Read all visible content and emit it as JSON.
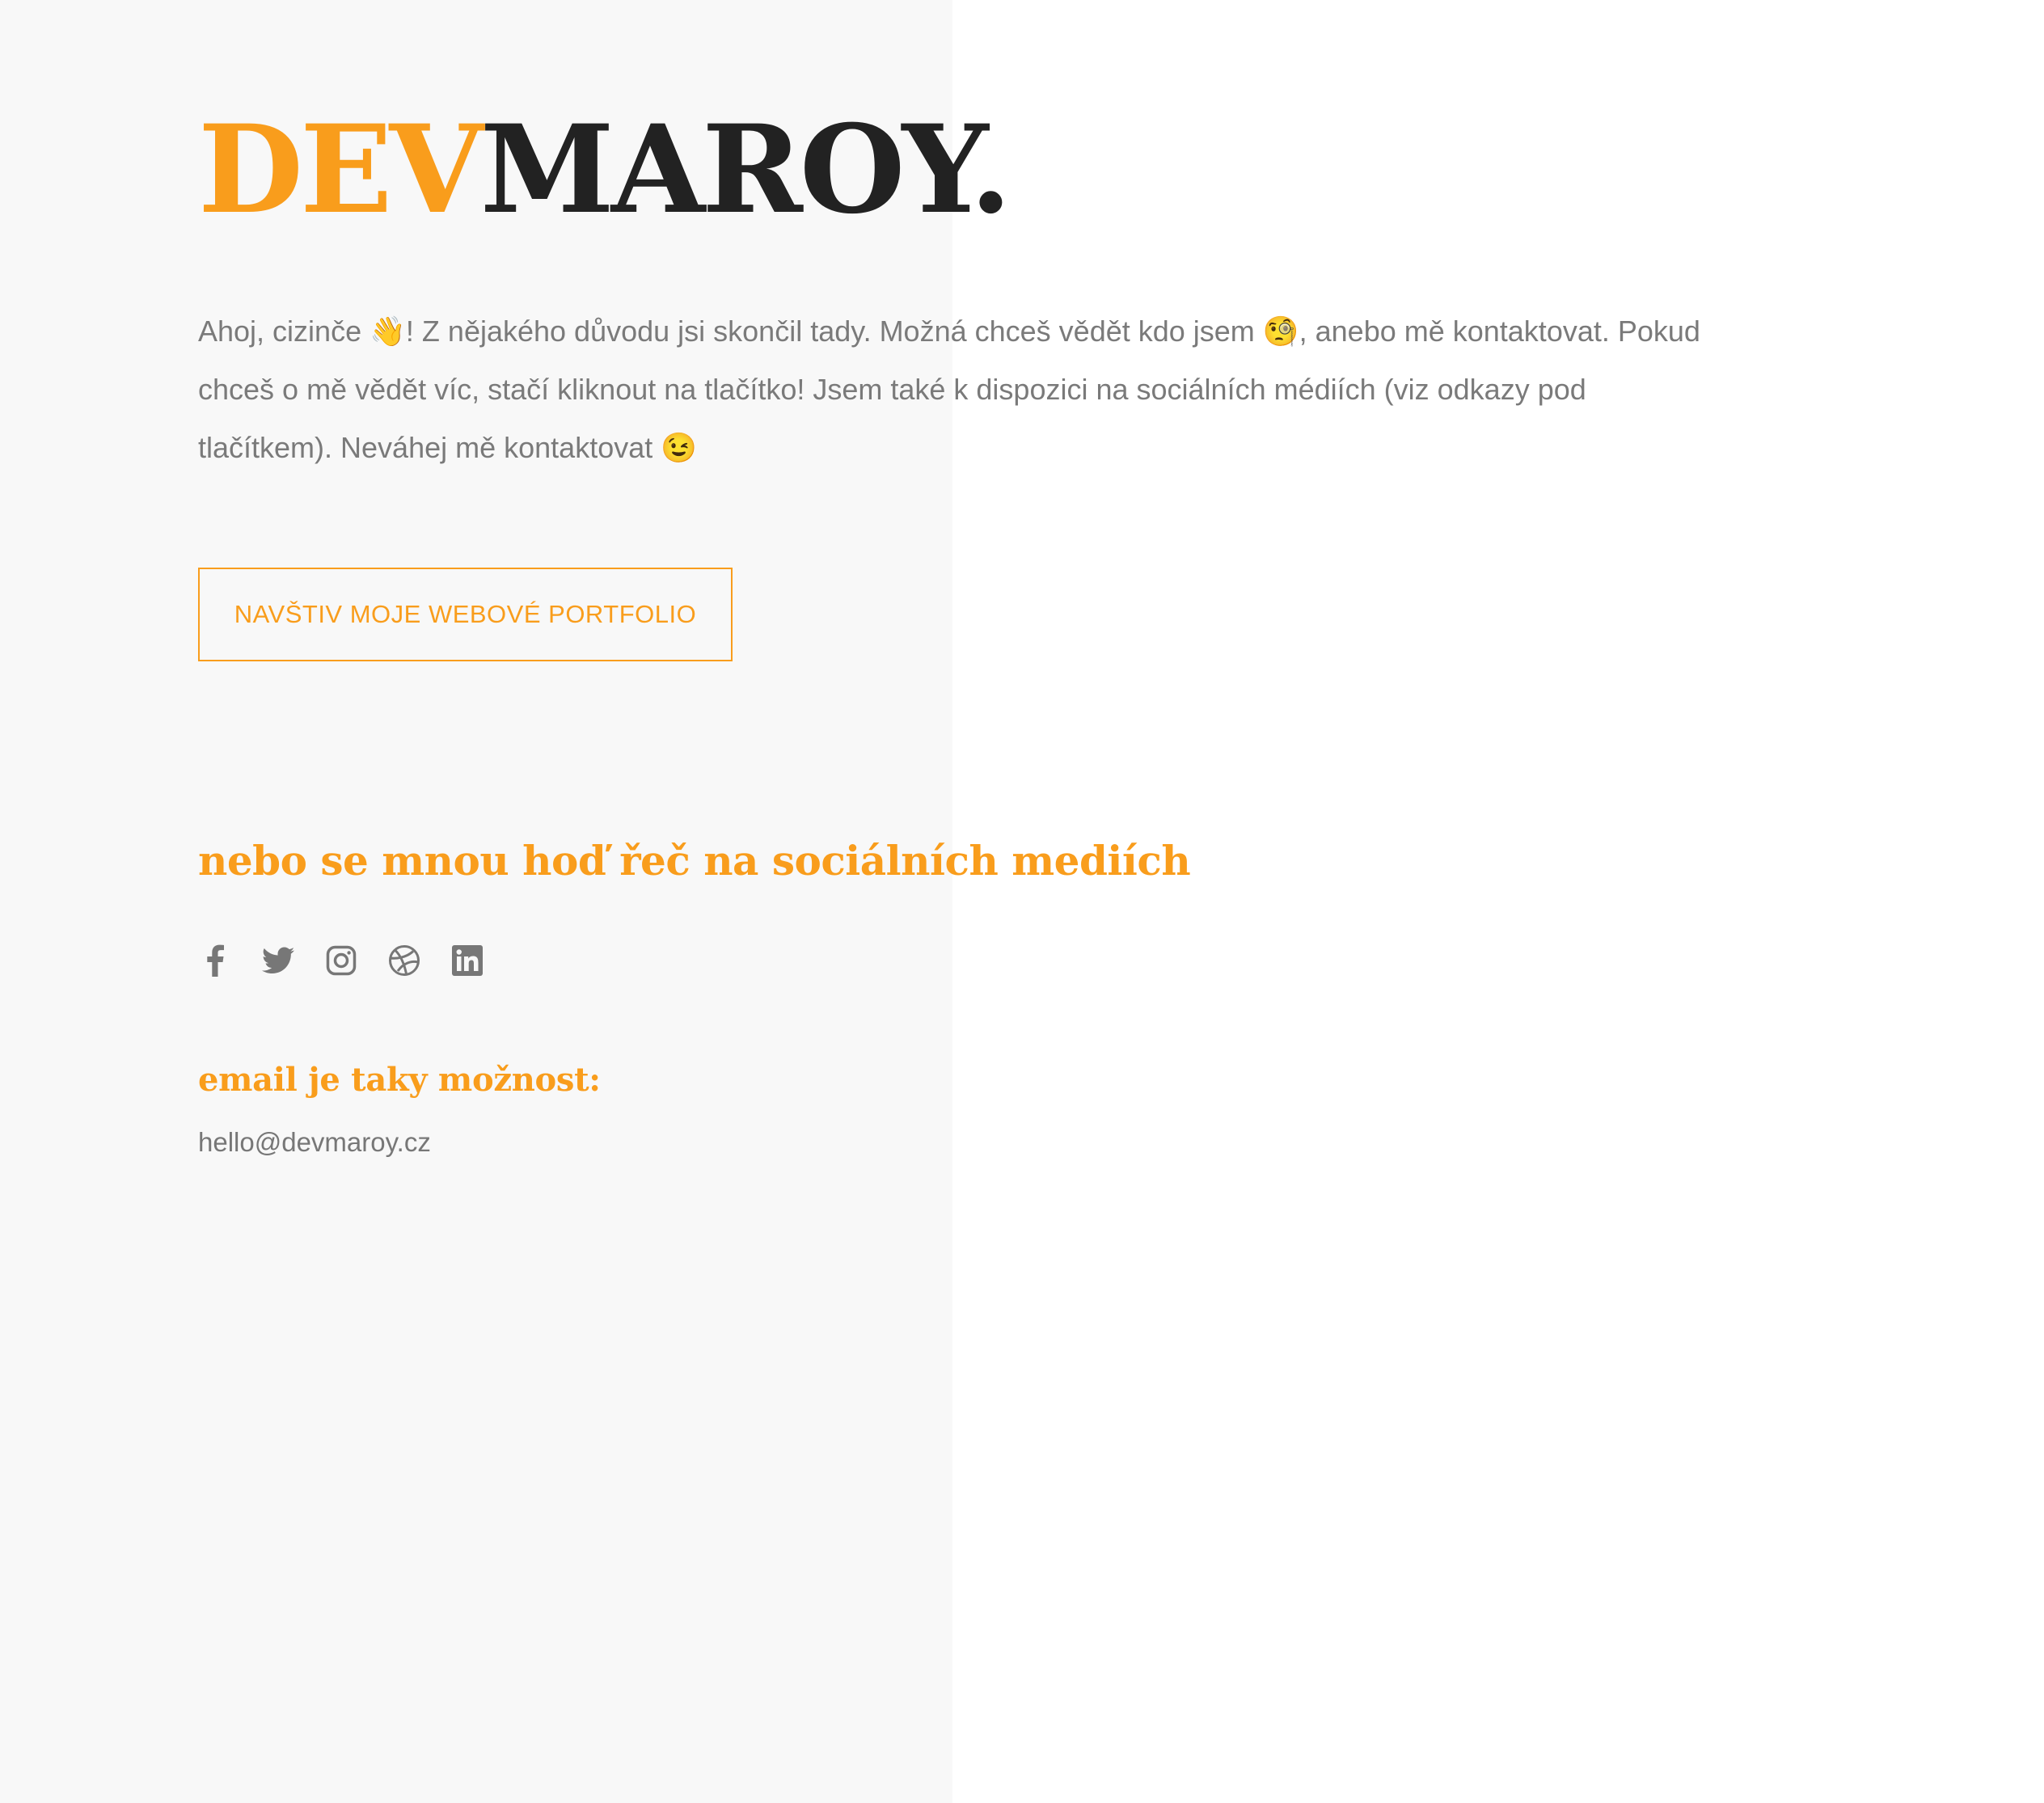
{
  "brand": {
    "part_accent": "DEV",
    "part_dark": "MAROY."
  },
  "intro": {
    "text": "Ahoj, cizinče 👋! Z nějakého důvodu jsi skončil tady. Možná chceš vědět kdo jsem 🧐, anebo mě kontaktovat. Pokud chceš o mě vědět víc, stačí kliknout na tlačítko! Jsem také k dispozici na sociálních médiích (viz odkazy pod tlačítkem). Neváhej mě kontaktovat 😉"
  },
  "cta": {
    "label": "NAVŠTIV MOJE WEBOVÉ PORTFOLIO"
  },
  "social": {
    "title": "nebo se mnou hoď řeč na sociálních mediích",
    "icons": [
      "facebook-icon",
      "twitter-icon",
      "instagram-icon",
      "dribbble-icon",
      "linkedin-icon"
    ]
  },
  "contact": {
    "title": "email je taky možnost:",
    "email": "hello@devmaroy.cz"
  },
  "colors": {
    "accent": "#f99d1c",
    "dark": "#222222",
    "text": "#7a7a7a",
    "panel": "#f8f8f8"
  }
}
